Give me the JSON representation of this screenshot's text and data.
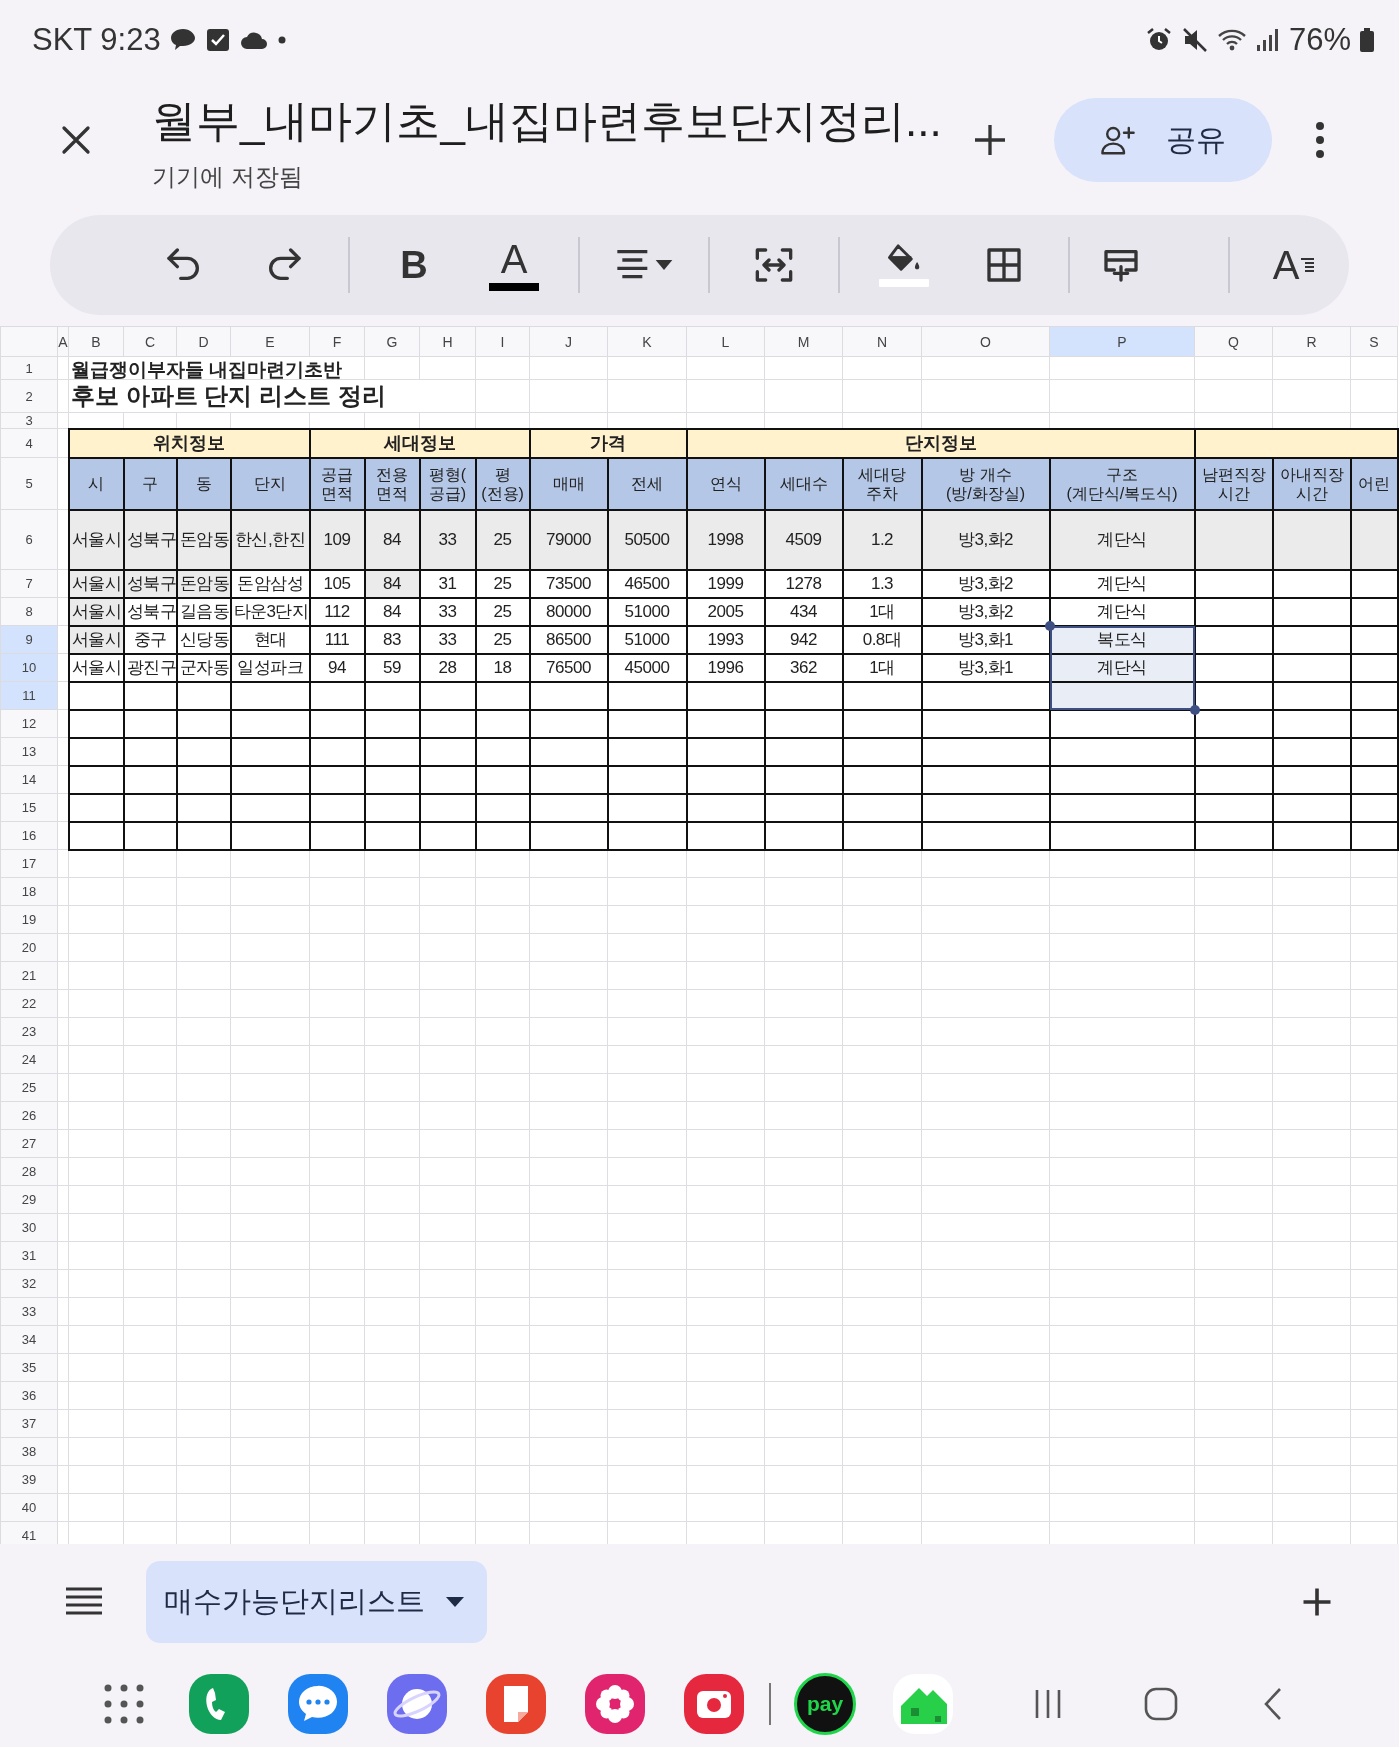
{
  "status_bar": {
    "carrier_time": "SKT 9:23",
    "battery": "76%"
  },
  "header": {
    "title": "월부_내마기초_내집마련후보단지정리...",
    "subtitle": "기기에 저장됨",
    "share_label": "공유"
  },
  "toolbar": [
    {
      "kind": "undo"
    },
    {
      "kind": "redo"
    },
    {
      "kind": "bold",
      "label": "B"
    },
    {
      "kind": "text-color",
      "label": "A",
      "color": "#000000"
    },
    {
      "kind": "align"
    },
    {
      "kind": "merge"
    },
    {
      "kind": "fill-color",
      "color": "#ffffff"
    },
    {
      "kind": "borders"
    },
    {
      "kind": "insert"
    },
    {
      "kind": "text-format",
      "label": "A"
    }
  ],
  "sheet": {
    "columns": [
      {
        "letter": "A",
        "selected": false
      },
      {
        "letter": "B",
        "selected": false
      },
      {
        "letter": "C",
        "selected": false
      },
      {
        "letter": "D",
        "selected": false
      },
      {
        "letter": "E",
        "selected": false
      },
      {
        "letter": "F",
        "selected": false
      },
      {
        "letter": "G",
        "selected": false
      },
      {
        "letter": "H",
        "selected": false
      },
      {
        "letter": "I",
        "selected": false
      },
      {
        "letter": "J",
        "selected": false
      },
      {
        "letter": "K",
        "selected": false
      },
      {
        "letter": "L",
        "selected": false
      },
      {
        "letter": "M",
        "selected": false
      },
      {
        "letter": "N",
        "selected": false
      },
      {
        "letter": "O",
        "selected": false
      },
      {
        "letter": "P",
        "selected": true
      },
      {
        "letter": "Q",
        "selected": false
      },
      {
        "letter": "R",
        "selected": false
      },
      {
        "letter": "S",
        "selected": false
      }
    ],
    "rows": [
      {
        "number": "1",
        "kind": "note",
        "selected": false,
        "cells": [
          "월급쟁이부자들 내집마련기초반"
        ]
      },
      {
        "number": "2",
        "kind": "title",
        "selected": false,
        "cells": [
          "후보 아파트 단지 리스트 정리"
        ]
      },
      {
        "number": "3",
        "kind": "gap",
        "selected": false
      },
      {
        "number": "4",
        "kind": "band",
        "selected": false,
        "cells": [
          "위치정보",
          "세대정보",
          "가격",
          "단지정보"
        ]
      },
      {
        "number": "5",
        "kind": "header",
        "selected": false,
        "cells": [
          null,
          "시",
          "구",
          "동",
          "단지",
          "공급\n면적",
          "전용\n면적",
          "평형(\n공급)",
          "평\n(전용)",
          "매매",
          "전세",
          "연식",
          "세대수",
          "세대당\n주차",
          "방 개수\n(방/화장실)",
          "구조\n(계단식/복도식)",
          "남편직장\n시간",
          "아내직장\n시간",
          "어린"
        ]
      },
      {
        "number": "6",
        "kind": "data",
        "selected": false,
        "cells": [
          null,
          "서울시",
          "성북구",
          "돈암동",
          "한신,한진",
          "109",
          "84",
          "33",
          "25",
          "79000",
          "50500",
          "1998",
          "4509",
          "1.2",
          "방3,화2",
          "계단식",
          null,
          null,
          null
        ],
        "shaded": [
          false,
          true,
          true,
          true,
          true,
          true,
          true,
          true,
          true,
          true,
          true,
          true,
          true,
          true,
          true,
          true,
          true,
          true,
          true
        ]
      },
      {
        "number": "7",
        "kind": "data",
        "selected": false,
        "cells": [
          null,
          "서울시",
          "성북구",
          "돈암동",
          "돈암삼성",
          "105",
          "84",
          "31",
          "25",
          "73500",
          "46500",
          "1999",
          "1278",
          "1.3",
          "방3,화2",
          "계단식",
          null,
          null,
          null
        ],
        "shaded": [
          false,
          true,
          true,
          true,
          false,
          false,
          true,
          false,
          false,
          false,
          false,
          false,
          false,
          false,
          false,
          false,
          false,
          false,
          false
        ]
      },
      {
        "number": "8",
        "kind": "data",
        "selected": false,
        "cells": [
          null,
          "서울시",
          "성북구",
          "길음동",
          "타운3단지",
          "112",
          "84",
          "33",
          "25",
          "80000",
          "51000",
          "2005",
          "434",
          "1대",
          "방3,화2",
          "계단식",
          null,
          null,
          null
        ],
        "shaded": [
          false,
          true,
          false,
          false,
          false,
          false,
          false,
          false,
          false,
          false,
          false,
          false,
          false,
          false,
          false,
          false,
          false,
          false,
          false
        ]
      },
      {
        "number": "9",
        "kind": "data",
        "selected": true,
        "cells": [
          null,
          "서울시",
          "중구",
          "신당동",
          "현대",
          "111",
          "83",
          "33",
          "25",
          "86500",
          "51000",
          "1993",
          "942",
          "0.8대",
          "방3,화1",
          "복도식",
          null,
          null,
          null
        ],
        "shaded": [
          false,
          true,
          false,
          false,
          false,
          false,
          false,
          false,
          false,
          false,
          false,
          false,
          false,
          false,
          false,
          false,
          false,
          false,
          false
        ]
      },
      {
        "number": "10",
        "kind": "data",
        "selected": true,
        "cells": [
          null,
          "서울시",
          "광진구",
          "군자동",
          "일성파크",
          "94",
          "59",
          "28",
          "18",
          "76500",
          "45000",
          "1996",
          "362",
          "1대",
          "방3,화1",
          "계단식",
          null,
          null,
          null
        ]
      },
      {
        "number": "11",
        "kind": "slot",
        "selected": true
      },
      {
        "number": "12",
        "kind": "slot",
        "selected": false
      },
      {
        "number": "13",
        "kind": "slot",
        "selected": false
      },
      {
        "number": "14",
        "kind": "slot",
        "selected": false
      },
      {
        "number": "15",
        "kind": "slot",
        "selected": false
      },
      {
        "number": "16",
        "kind": "slot",
        "selected": false
      },
      {
        "number": "17",
        "kind": "empty",
        "selected": false
      },
      {
        "number": "18",
        "kind": "empty",
        "selected": false
      },
      {
        "number": "19",
        "kind": "empty",
        "selected": false
      },
      {
        "number": "20",
        "kind": "empty",
        "selected": false
      },
      {
        "number": "21",
        "kind": "empty",
        "selected": false
      },
      {
        "number": "22",
        "kind": "empty",
        "selected": false
      },
      {
        "number": "23",
        "kind": "empty",
        "selected": false
      },
      {
        "number": "24",
        "kind": "empty",
        "selected": false
      },
      {
        "number": "25",
        "kind": "empty",
        "selected": false
      },
      {
        "number": "26",
        "kind": "empty",
        "selected": false
      },
      {
        "number": "27",
        "kind": "empty",
        "selected": false
      },
      {
        "number": "28",
        "kind": "empty",
        "selected": false
      },
      {
        "number": "29",
        "kind": "empty",
        "selected": false
      },
      {
        "number": "30",
        "kind": "empty",
        "selected": false
      },
      {
        "number": "31",
        "kind": "empty",
        "selected": false
      },
      {
        "number": "32",
        "kind": "empty",
        "selected": false
      },
      {
        "number": "33",
        "kind": "empty",
        "selected": false
      },
      {
        "number": "34",
        "kind": "empty",
        "selected": false
      },
      {
        "number": "35",
        "kind": "empty",
        "selected": false
      },
      {
        "number": "36",
        "kind": "empty",
        "selected": false
      },
      {
        "number": "37",
        "kind": "empty",
        "selected": false
      },
      {
        "number": "38",
        "kind": "empty",
        "selected": false
      },
      {
        "number": "39",
        "kind": "empty",
        "selected": false
      },
      {
        "number": "40",
        "kind": "empty",
        "selected": false
      },
      {
        "number": "41",
        "kind": "empty",
        "selected": false
      }
    ]
  },
  "sheet_tabs": [
    {
      "label": "매수가능단지리스트",
      "selected": true
    }
  ],
  "nav_bar": {
    "apps": [
      {
        "kind": "apps"
      },
      {
        "kind": "phone"
      },
      {
        "kind": "messages"
      },
      {
        "kind": "browser"
      },
      {
        "kind": "notes"
      },
      {
        "kind": "gallery"
      },
      {
        "kind": "camera"
      },
      {
        "kind": "pay",
        "label": "pay"
      },
      {
        "kind": "home-app"
      }
    ]
  }
}
